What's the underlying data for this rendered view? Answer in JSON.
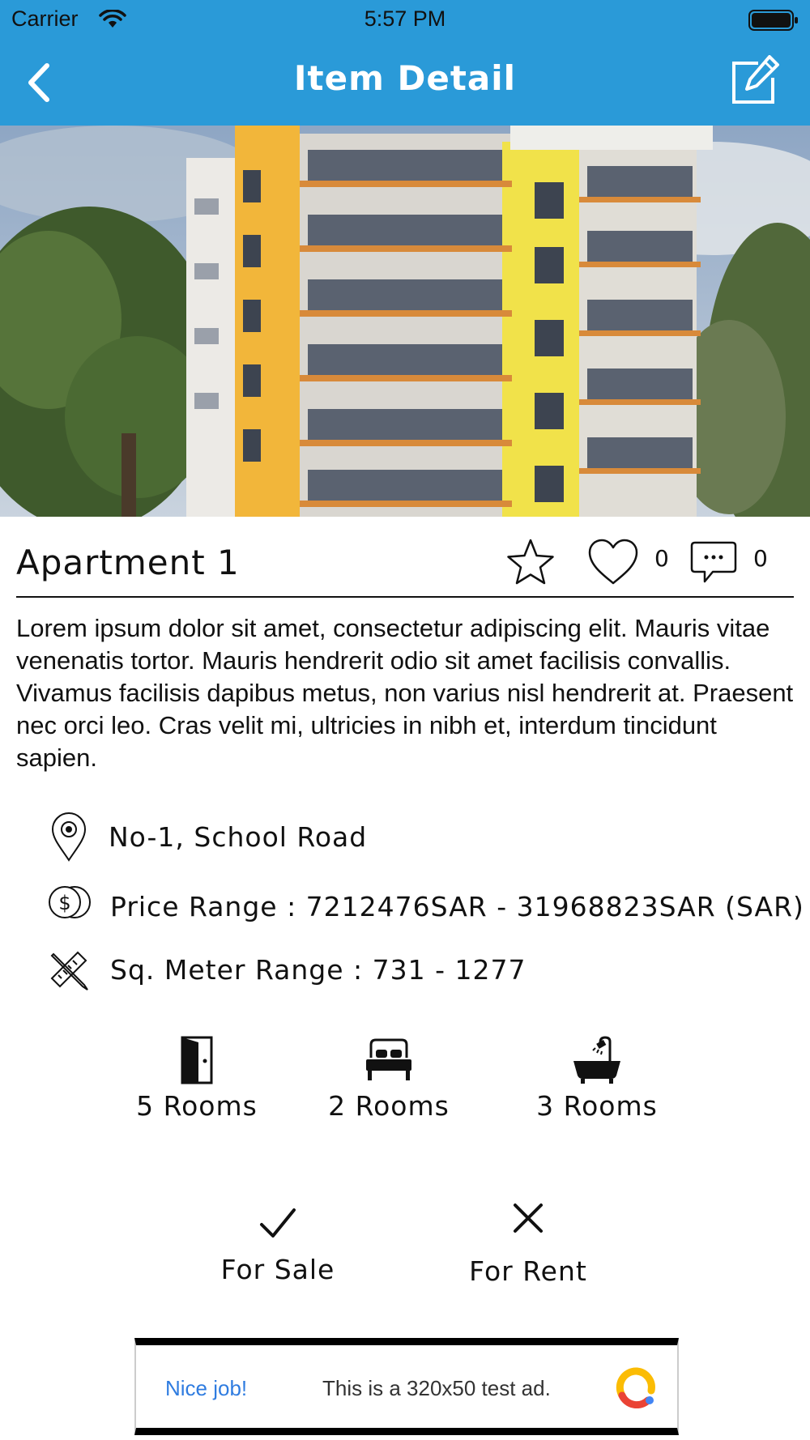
{
  "status_bar": {
    "carrier": "Carrier",
    "time": "5:57 PM"
  },
  "nav": {
    "title": "Item Detail"
  },
  "item": {
    "title": "Apartment 1",
    "like_count": "0",
    "comment_count": "0",
    "description": "Lorem ipsum dolor sit amet, consectetur adipiscing elit. Mauris vitae venenatis tortor. Mauris hendrerit odio sit amet facilisis convallis. Vivamus facilisis dapibus metus, non varius nisl hendrerit at. Praesent nec orci leo. Cras velit mi, ultricies in nibh et, interdum tincidunt sapien."
  },
  "info": {
    "address": "No-1, School Road",
    "price_range": "Price Range : 7212476SAR - 31968823SAR (SAR)",
    "sqm_range": "Sq. Meter Range : 731 - 1277"
  },
  "rooms": [
    {
      "icon": "door-icon",
      "label": "5 Rooms"
    },
    {
      "icon": "bed-icon",
      "label": "2 Rooms"
    },
    {
      "icon": "bathtub-icon",
      "label": "3 Rooms"
    }
  ],
  "deal": {
    "sale": {
      "icon": "checkmark-icon",
      "label": "For Sale"
    },
    "rent": {
      "icon": "cross-icon",
      "label": "For Rent"
    }
  },
  "ad": {
    "headline": "Nice job!",
    "text": "This is a 320x50 test ad."
  },
  "colors": {
    "nav_bar": "#2a9ad8",
    "ad_link": "#2f7ce0"
  }
}
